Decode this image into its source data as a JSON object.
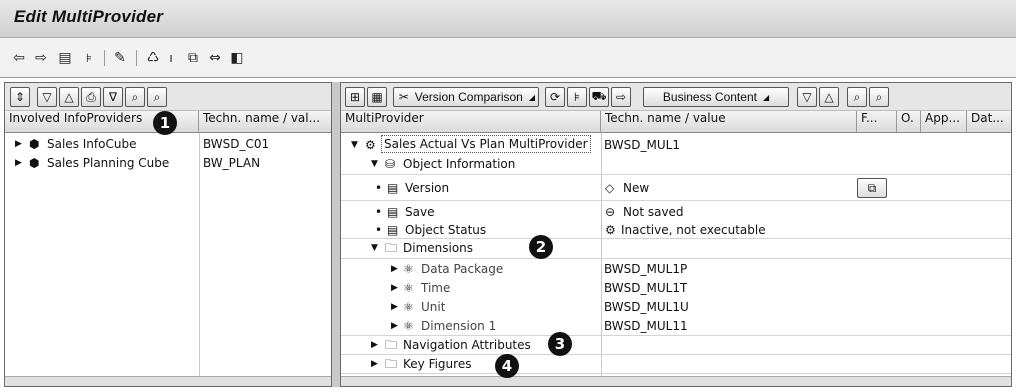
{
  "window": {
    "title": "Edit MultiProvider"
  },
  "app_toolbar": {
    "icons": [
      "back-arrow-icon",
      "forward-arrow-icon",
      "display-icon",
      "hierarchy-icon",
      "pencil-icon",
      "activate-icon",
      "info-icon",
      "object-directory-icon",
      "transport-icon",
      "documents-icon"
    ]
  },
  "left_tree": {
    "toolbar_icons": [
      "expand-icon",
      "collapse-all-icon",
      "expand-all-icon",
      "print-icon",
      "filter-icon",
      "find-icon",
      "find-next-icon"
    ],
    "columns": [
      "Involved InfoProviders",
      "Techn. name / val..."
    ],
    "rows": [
      {
        "label": "Sales InfoCube",
        "value": "BWSD_C01"
      },
      {
        "label": "Sales Planning Cube",
        "value": "BW_PLAN"
      }
    ]
  },
  "right_tree": {
    "toolbar": {
      "version_comparison": "Version Comparison",
      "business_content": "Business Content"
    },
    "columns": [
      "MultiProvider",
      "Techn. name / value",
      "F...",
      "O.",
      "App...",
      "Dat..."
    ],
    "root": {
      "label": "Sales Actual Vs Plan MultiProvider",
      "value": "BWSD_MUL1"
    },
    "object_information": {
      "label": "Object Information",
      "rows": [
        {
          "label": "Version",
          "value": "New",
          "symbol": "◇"
        },
        {
          "label": "Save",
          "value": "Not saved",
          "symbol": "⊖"
        },
        {
          "label": "Object Status",
          "value": "Inactive, not executable",
          "symbol": "⚙"
        }
      ]
    },
    "dimensions": {
      "label": "Dimensions",
      "rows": [
        {
          "label": "Data Package",
          "value": "BWSD_MUL1P"
        },
        {
          "label": "Time",
          "value": "BWSD_MUL1T"
        },
        {
          "label": "Unit",
          "value": "BWSD_MUL1U"
        },
        {
          "label": "Dimension 1",
          "value": "BWSD_MUL11"
        }
      ]
    },
    "navigation_attributes": {
      "label": "Navigation Attributes"
    },
    "key_figures": {
      "label": "Key Figures"
    }
  },
  "callouts": [
    "1",
    "2",
    "3",
    "4"
  ]
}
